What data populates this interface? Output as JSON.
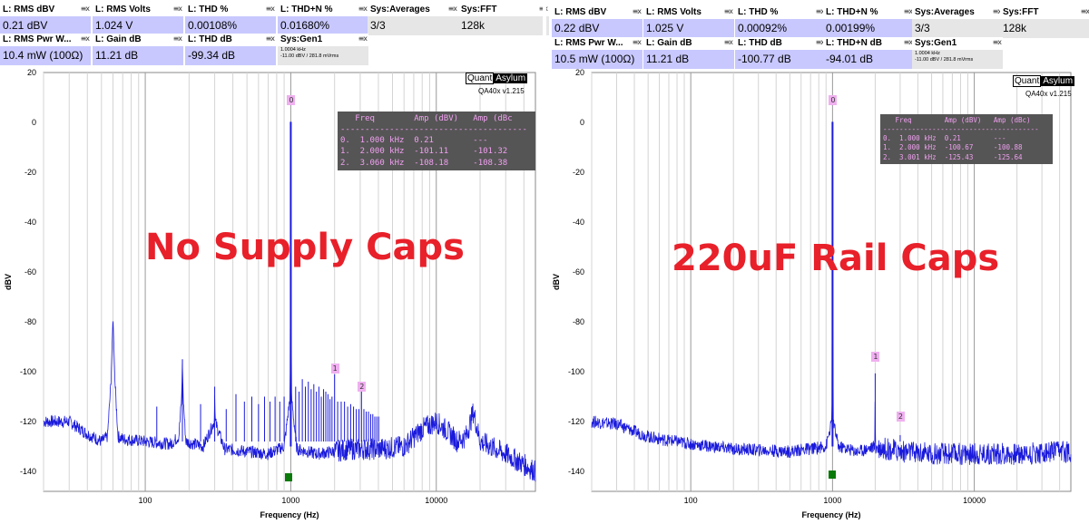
{
  "tile_controls": "≡x",
  "panels": [
    {
      "id": "left",
      "tiles": {
        "rms_dbv": {
          "title": "L: RMS dBV",
          "value": "0.21 dBV"
        },
        "rms_volts": {
          "title": "L: RMS Volts",
          "value": "1.024 V"
        },
        "thd_pct": {
          "title": "L: THD %",
          "value": "0.00108%"
        },
        "thdn_pct": {
          "title": "L: THD+N %",
          "value": "0.01680%"
        },
        "averages": {
          "title": "Sys:Averages",
          "value": "3/3"
        },
        "fft": {
          "title": "Sys:FFT",
          "value": "128k"
        },
        "pwr": {
          "title": "L: RMS Pwr W...",
          "value": "10.4 mW (100Ω)"
        },
        "gain": {
          "title": "L: Gain dB",
          "value": "11.21 dB"
        },
        "thd_db": {
          "title": "L: THD dB",
          "value": "-99.34 dB"
        },
        "gen": {
          "title": "Sys:Gen1",
          "line1": "1.0004 kHz",
          "line2": "-11.00 dBV / 281.8 mVrms"
        }
      },
      "brand": {
        "a": "Quant",
        "b": "Asylum",
        "version": "QA40x v1.215"
      },
      "peak_table": {
        "header": "   Freq        Amp (dBV)   Amp (dBc",
        "sep": "--------------------------------------",
        "rows": [
          "0.  1.000 kHz  0.21        ---",
          "1.  2.000 kHz  -101.11     -101.32",
          "2.  3.060 kHz  -108.18     -108.38"
        ]
      },
      "overlay_text": "No Supply Caps",
      "markers": [
        "0",
        "1",
        "2"
      ]
    },
    {
      "id": "right",
      "tiles": {
        "rms_dbv": {
          "title": "L: RMS dBV",
          "value": "0.22 dBV"
        },
        "rms_volts": {
          "title": "L: RMS Volts",
          "value": "1.025 V"
        },
        "thd_pct": {
          "title": "L: THD %",
          "value": "0.00092%"
        },
        "thdn_pct": {
          "title": "L: THD+N %",
          "value": "0.00199%"
        },
        "averages": {
          "title": "Sys:Averages",
          "value": "3/3"
        },
        "fft": {
          "title": "Sys:FFT",
          "value": "128k"
        },
        "pwr": {
          "title": "L: RMS Pwr W...",
          "value": "10.5 mW (100Ω)"
        },
        "gain": {
          "title": "L: Gain dB",
          "value": "11.21 dB"
        },
        "thd_db": {
          "title": "L: THD dB",
          "value": "-100.77 dB"
        },
        "thdn_db": {
          "title": "L: THD+N dB",
          "value": "-94.01 dB"
        },
        "gen": {
          "title": "Sys:Gen1",
          "line1": "1.0004 kHz",
          "line2": "-11.00 dBV / 281.8 mVrms"
        }
      },
      "brand": {
        "a": "Quant",
        "b": "Asylum",
        "version": "QA40x v1.215"
      },
      "peak_table": {
        "header": "   Freq        Amp (dBV)   Amp (dBc)",
        "sep": "--------------------------------------",
        "rows": [
          "0.  1.000 kHz  0.21        ---",
          "1.  2.000 kHz  -100.67     -100.88",
          "2.  3.001 kHz  -125.43     -125.64"
        ]
      },
      "overlay_text": "220uF Rail Caps",
      "markers": [
        "0",
        "1",
        "2"
      ]
    }
  ],
  "chart_data": [
    {
      "type": "line",
      "title": "",
      "xlabel": "Frequency (Hz)",
      "ylabel": "dBV",
      "xscale": "log",
      "xlim": [
        20,
        48000
      ],
      "ylim": [
        -148,
        20
      ],
      "xticks": [
        100,
        1000,
        10000
      ],
      "xtick_labels": [
        "100",
        "1000",
        "10000"
      ],
      "yticks": [
        20,
        0,
        -20,
        -40,
        -60,
        -80,
        -100,
        -120,
        -140
      ],
      "grid": true,
      "line_color": "#1a1adc",
      "series": [
        {
          "x": [
            20,
            30,
            40,
            50,
            55,
            58,
            60,
            62,
            65,
            70,
            100,
            150,
            170,
            178,
            180,
            182,
            190,
            250,
            298,
            300,
            302,
            350,
            500,
            700,
            900,
            990,
            1000,
            1010,
            1100,
            1500,
            2000,
            2500,
            3000,
            4000,
            6000,
            8000,
            10000,
            12000,
            14000,
            16000,
            18000,
            20000,
            30000,
            48000
          ],
          "y": [
            -120,
            -120,
            -125,
            -128,
            -126,
            -105,
            -78,
            -105,
            -126,
            -127,
            -128,
            -129,
            -126,
            -110,
            -94,
            -110,
            -128,
            -130,
            -120,
            -106,
            -120,
            -131,
            -132,
            -133,
            -130,
            -110,
            0.21,
            -110,
            -131,
            -133,
            -132,
            -131,
            -131,
            -131,
            -130,
            -123,
            -120,
            -124,
            -128,
            -126,
            -116,
            -128,
            -133,
            -140
          ]
        },
        {
          "x": [
            20,
            30,
            40,
            50,
            60,
            80,
            100,
            200,
            500,
            900,
            990,
            1000,
            1010,
            1100,
            1500,
            1990,
            2000,
            2010,
            3000,
            5000,
            10000,
            20000,
            48000
          ],
          "y": [
            -120,
            -121,
            -124,
            -126,
            -127,
            -128,
            -129,
            -131,
            -132,
            -130,
            -120,
            0.22,
            -120,
            -130,
            -132,
            -130,
            -100.67,
            -130,
            -132,
            -133,
            -133,
            -133,
            -132
          ]
        }
      ],
      "harmonic_lines": [
        {
          "x": [
            120,
            180,
            240,
            300,
            360,
            420,
            480,
            540,
            600,
            660,
            720,
            780,
            840,
            900,
            1080,
            1140,
            1200,
            1260,
            1320,
            1380,
            1440,
            1500,
            1560,
            1620,
            1680,
            1740,
            1800,
            1860,
            1920,
            2000,
            2100,
            2220,
            2340,
            2460,
            2580,
            2700,
            2820,
            2940,
            3060,
            3180,
            3300,
            3420,
            3540,
            3660,
            3780,
            3900,
            4020
          ],
          "y": [
            -114,
            -95,
            -113,
            -106,
            -115,
            -109,
            -112,
            -110,
            -113,
            -110,
            -112,
            -110,
            -112,
            -110,
            -106,
            -108,
            -103,
            -106,
            -104,
            -107,
            -105,
            -108,
            -106,
            -110,
            -107,
            -108,
            -109,
            -111,
            -110,
            -101,
            -112,
            -112,
            -112,
            -114,
            -113,
            -114,
            -115,
            -115,
            -108,
            -115,
            -116,
            -116,
            -117,
            -117,
            -118,
            -118,
            -118
          ]
        },
        {
          "x": [
            2000,
            3001
          ],
          "y": [
            -100.67,
            -125.43
          ]
        }
      ]
    }
  ]
}
